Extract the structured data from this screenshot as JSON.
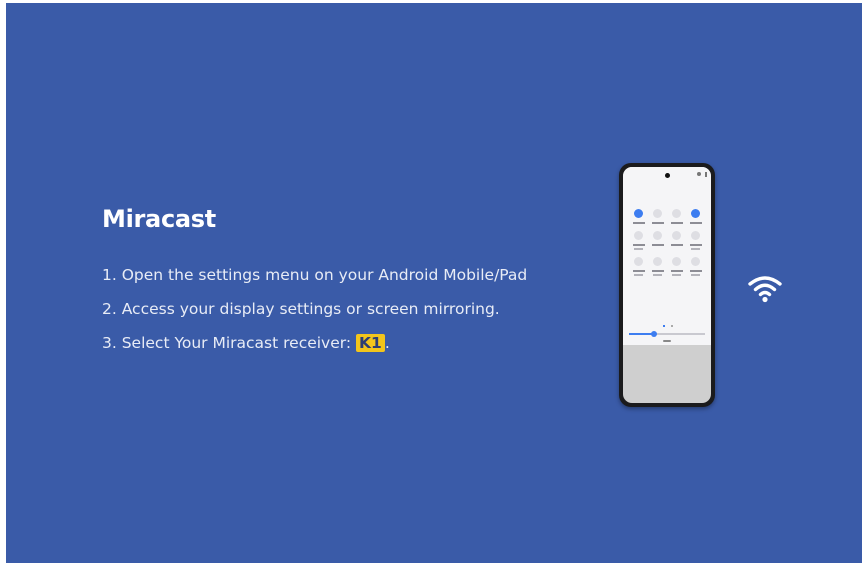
{
  "title": "Miracast",
  "steps": [
    "1. Open the settings menu on your Android Mobile/Pad",
    "2. Access your display settings or screen mirroring.",
    "3. Select Your Miracast receiver:"
  ],
  "receiver_name": "K1",
  "receiver_suffix": ".",
  "colors": {
    "background": "#3a5ba8",
    "highlight": "#f2c51c",
    "text": "#ffffff"
  },
  "icons": {
    "wifi": "wifi-icon",
    "phone": "smartphone-illustration"
  }
}
